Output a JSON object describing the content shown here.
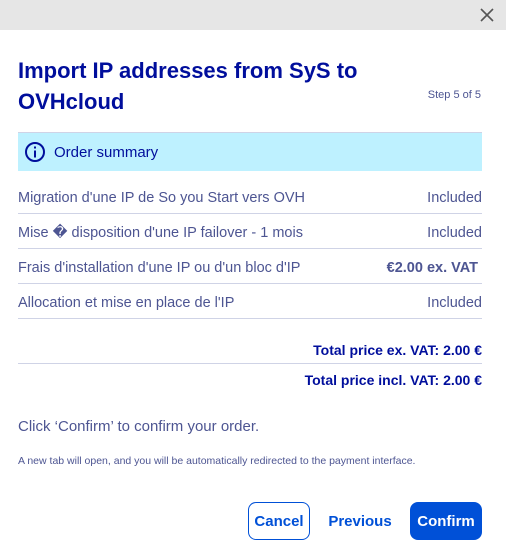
{
  "dialog": {
    "title": "Import IP addresses from SyS to OVHcloud",
    "step": "Step 5 of 5"
  },
  "summary": {
    "heading": "Order summary",
    "items": [
      {
        "label": "Migration d'une IP de So you Start vers OVH",
        "value": "Included"
      },
      {
        "label": "Mise � disposition d'une IP failover - 1 mois",
        "value": "Included"
      },
      {
        "label": "Frais d'installation d'une IP ou d'un bloc d'IP",
        "value": "€2.00 ex. VAT"
      },
      {
        "label": "Allocation et mise en place de l'IP",
        "value": "Included"
      }
    ],
    "total_ex_vat": "Total price ex. VAT: 2.00 €",
    "total_incl_vat": "Total price incl. VAT: 2.00 €"
  },
  "messages": {
    "confirm_instruction": "Click ‘Confirm’ to confirm your order.",
    "redirect_note": "A new tab will open, and you will be automatically redirected to the payment interface."
  },
  "buttons": {
    "cancel": "Cancel",
    "previous": "Previous",
    "confirm": "Confirm"
  },
  "colors": {
    "brand_dark": "#000e9c",
    "primary": "#0050d7",
    "info_bg": "#bef1ff",
    "text": "#4d5592"
  }
}
